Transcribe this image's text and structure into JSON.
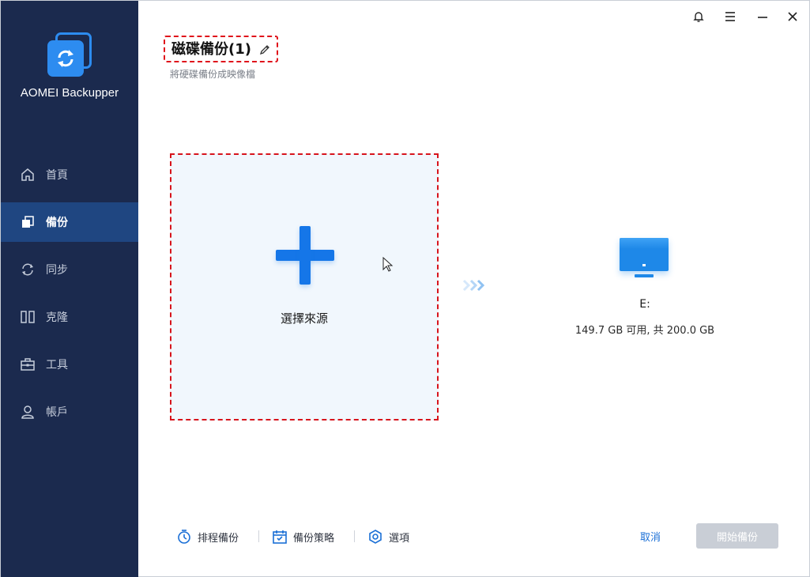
{
  "app": {
    "name": "AOMEI Backupper"
  },
  "sidebar": {
    "items": [
      {
        "label": "首頁",
        "icon": "home-icon"
      },
      {
        "label": "備份",
        "icon": "backup-icon",
        "active": true
      },
      {
        "label": "同步",
        "icon": "sync-icon"
      },
      {
        "label": "克隆",
        "icon": "clone-icon"
      },
      {
        "label": "工具",
        "icon": "toolbox-icon"
      },
      {
        "label": "帳戶",
        "icon": "user-icon"
      }
    ]
  },
  "header": {
    "title": "磁碟備份(1)",
    "subtitle": "將硬碟備份成映像檔"
  },
  "source": {
    "label": "選擇來源"
  },
  "destination": {
    "drive": "E:",
    "size": "149.7 GB 可用, 共 200.0 GB"
  },
  "footer": {
    "schedule_label": "排程備份",
    "scheme_label": "備份策略",
    "options_label": "選項",
    "cancel_label": "取消",
    "start_label": "開始備份"
  },
  "colors": {
    "sidebar_bg": "#1b2a4e",
    "sidebar_active": "#1f4681",
    "accent": "#1576e8",
    "dashed_highlight": "#e0131b",
    "disabled_button": "#c9ced6"
  }
}
